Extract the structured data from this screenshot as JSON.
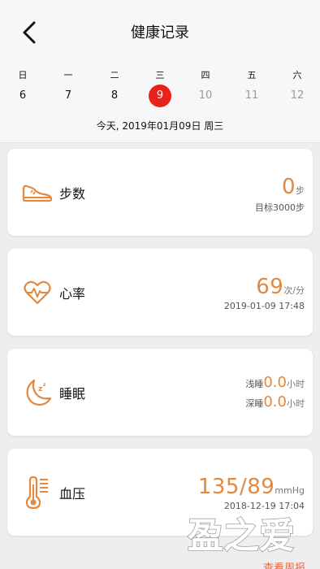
{
  "header": {
    "title": "健康记录"
  },
  "calendar": {
    "weekdays": [
      "日",
      "一",
      "二",
      "三",
      "四",
      "五",
      "六"
    ],
    "dates": [
      "6",
      "7",
      "8",
      "9",
      "10",
      "11",
      "12"
    ],
    "selected_index": 3,
    "today_text": "今天, 2019年01月09日 周三"
  },
  "cards": {
    "steps": {
      "label": "步数",
      "value": "0",
      "unit": "步",
      "sub": "目标3000步"
    },
    "heart": {
      "label": "心率",
      "value": "69",
      "unit": "次/分",
      "sub": "2019-01-09 17:48"
    },
    "sleep": {
      "label": "睡眠",
      "light_label": "浅睡",
      "light_value": "0.0",
      "light_unit": "小时",
      "deep_label": "深睡",
      "deep_value": "0.0",
      "deep_unit": "小时"
    },
    "bp": {
      "label": "血压",
      "value": "135/89",
      "unit": "mmHg",
      "sub": "2018-12-19 17:04"
    }
  },
  "footer": {
    "more_link": "查看周报"
  },
  "watermark": {
    "text": "盈之爱"
  },
  "colors": {
    "accent": "#e3883f",
    "selected": "#e8221b",
    "background": "#eeeef0"
  }
}
